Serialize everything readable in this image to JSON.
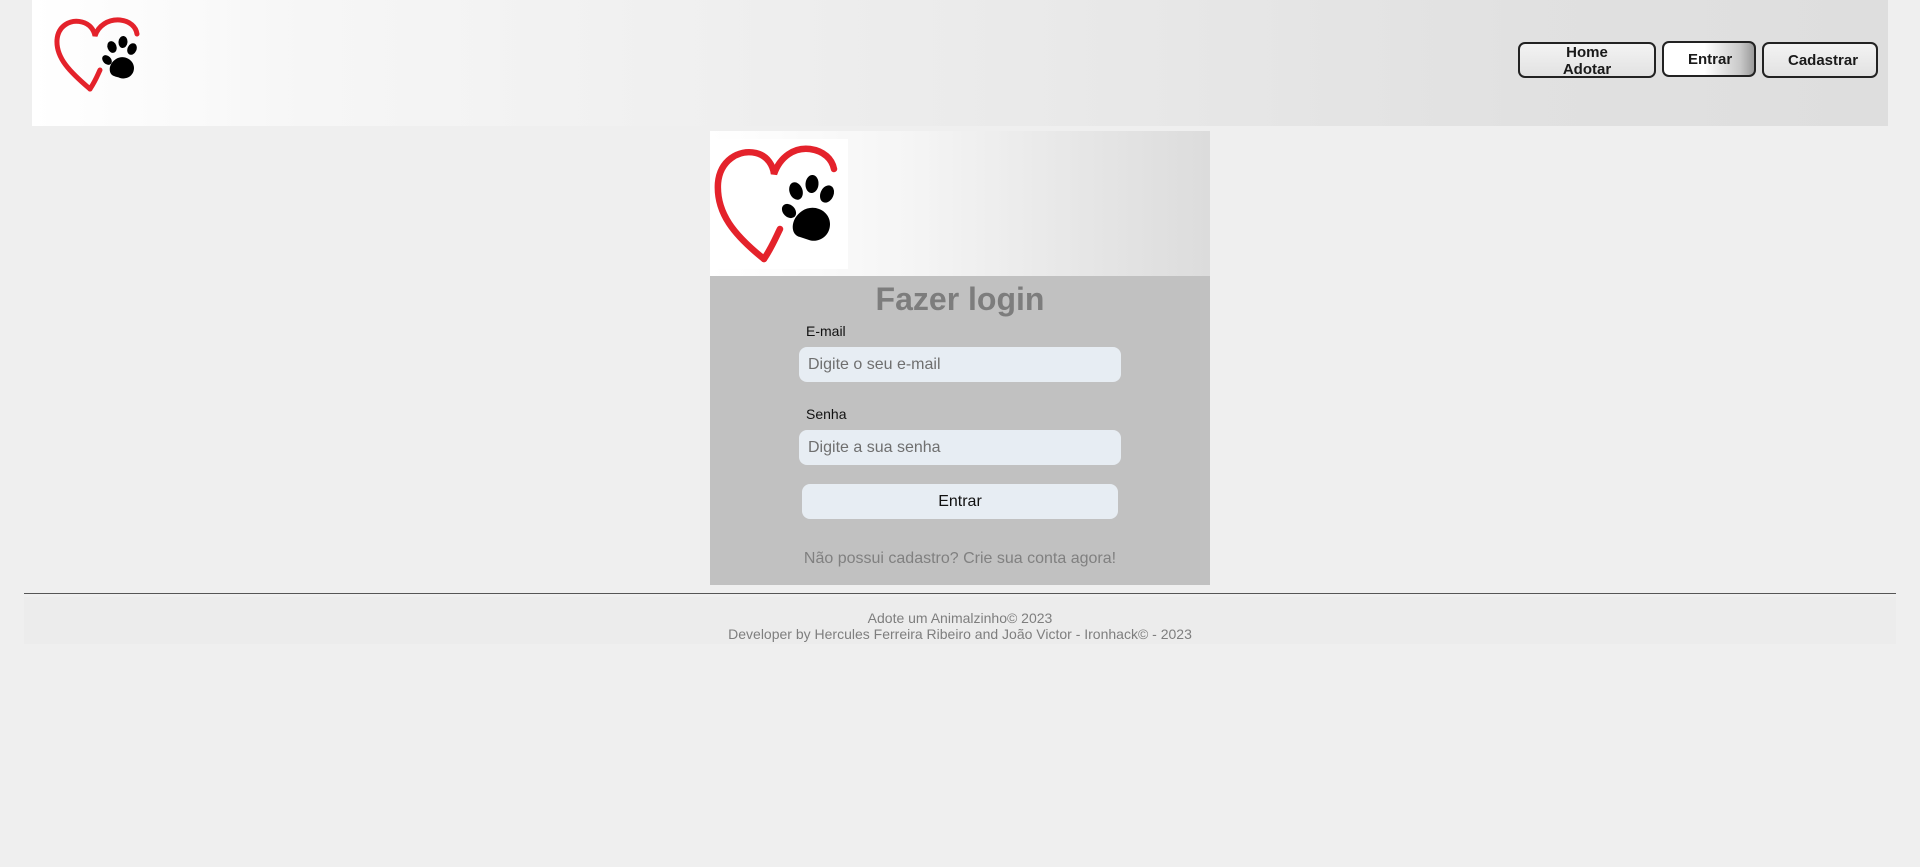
{
  "header": {
    "logo_icon": "heart-paw-logo",
    "nav": {
      "home_label": "Home Adotar",
      "login_label": "Entrar",
      "signup_label": "Cadastrar"
    }
  },
  "login_card": {
    "logo_icon": "heart-paw-logo",
    "title": "Fazer login",
    "email": {
      "label": "E-mail",
      "value": "",
      "placeholder": "Digite o seu e-mail"
    },
    "password": {
      "label": "Senha",
      "value": "",
      "placeholder": "Digite a sua senha"
    },
    "submit_label": "Entrar",
    "signup_link": "Não possui cadastro? Crie sua conta agora!"
  },
  "footer": {
    "line1": "Adote um Animalzinho© 2023",
    "line2": "Developer by Hercules Ferreira Ribeiro and João Victor - Ironhack© - 2023"
  },
  "colors": {
    "heart_red": "#e4222b",
    "paw_black": "#000000",
    "card_background": "#c1c1c1",
    "input_background": "#e7edf3",
    "page_background": "#efefef"
  }
}
